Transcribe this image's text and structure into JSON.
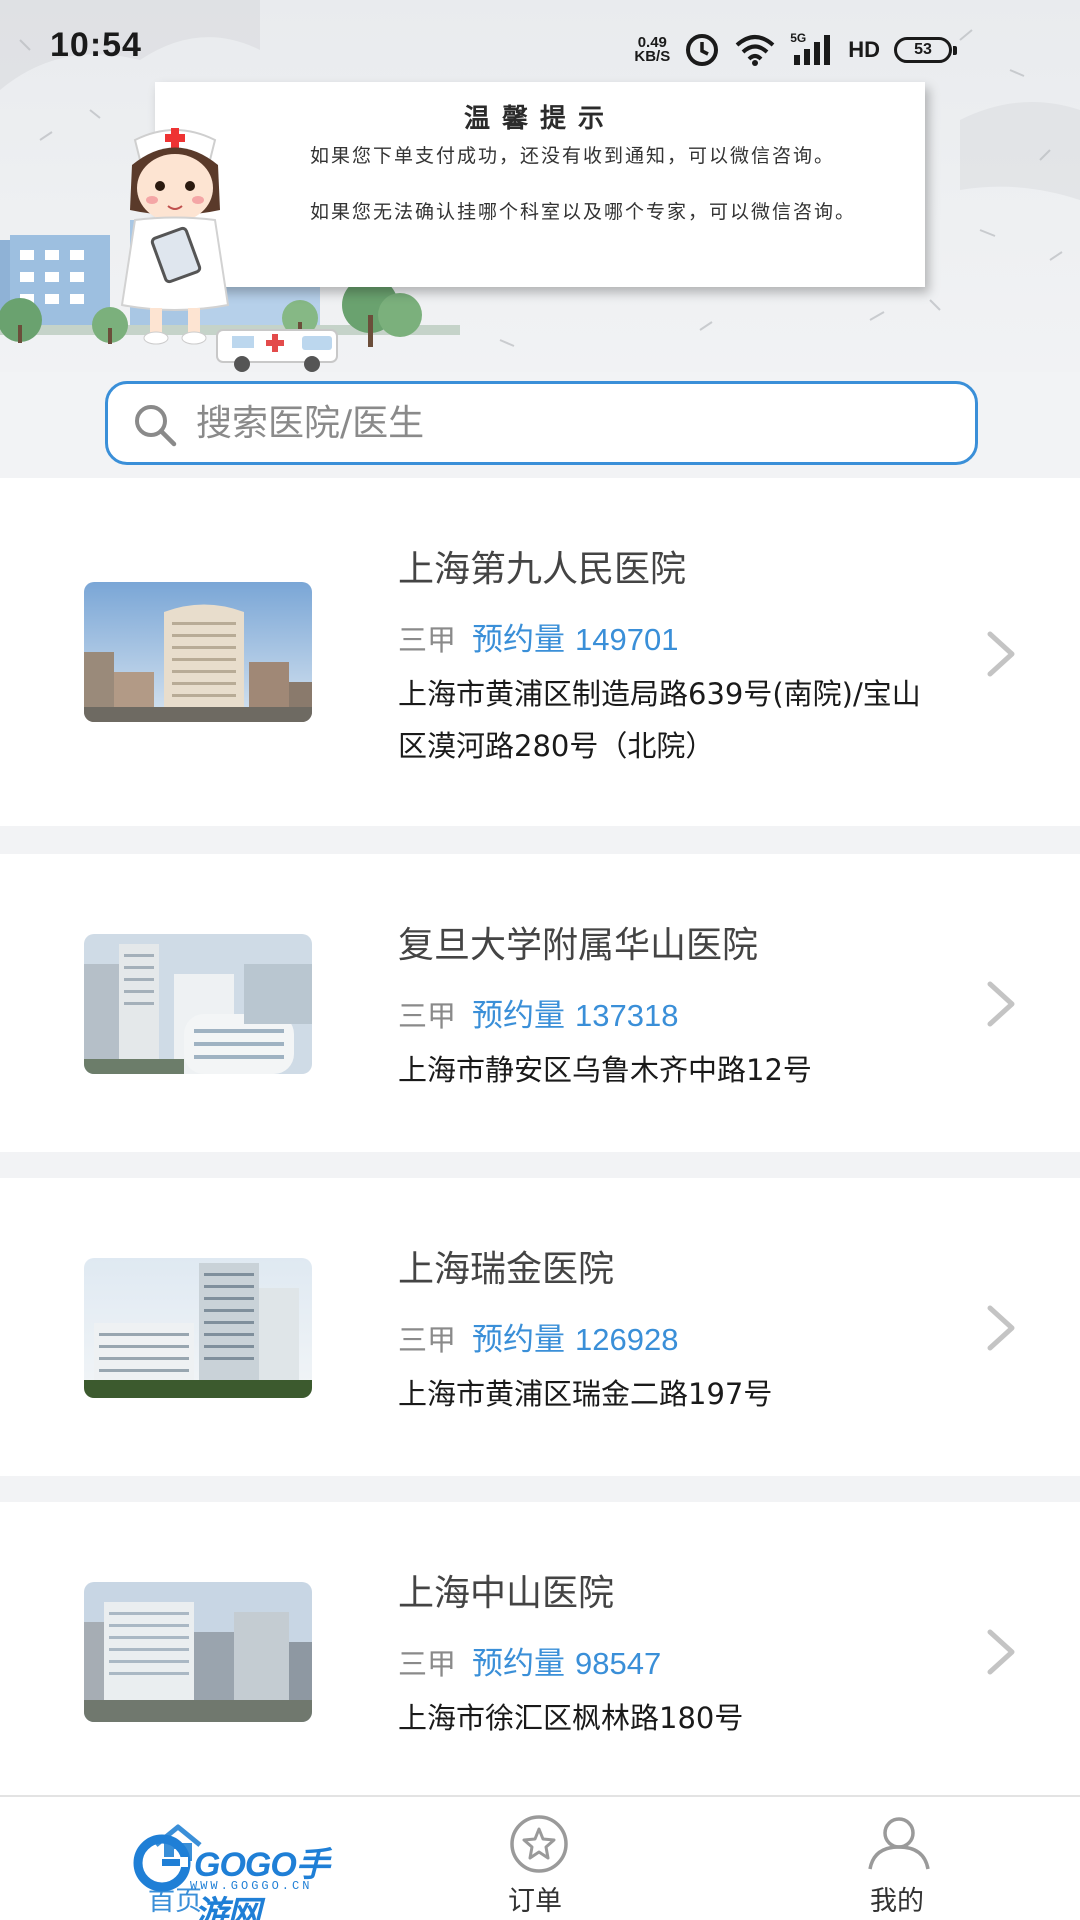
{
  "status_bar": {
    "time": "10:54",
    "net_speed_value": "0.49",
    "net_speed_unit": "KB/S",
    "signal_label": "5G",
    "hd_label": "HD",
    "battery": "53"
  },
  "notice": {
    "title": "温馨提示",
    "line1": "如果您下单支付成功，还没有收到通知，可以微信咨询。",
    "line2": "如果您无法确认挂哪个科室以及哪个专家，可以微信咨询。"
  },
  "search": {
    "placeholder": "搜索医院/医生"
  },
  "hospitals": [
    {
      "name": "上海第九人民医院",
      "level": "三甲",
      "count_label": "预约量",
      "count": "149701",
      "address": "上海市黄浦区制造局路639号(南院)/宝山区漠河路280号（北院）"
    },
    {
      "name": "复旦大学附属华山医院",
      "level": "三甲",
      "count_label": "预约量",
      "count": "137318",
      "address": "上海市静安区乌鲁木齐中路12号"
    },
    {
      "name": "上海瑞金医院",
      "level": "三甲",
      "count_label": "预约量",
      "count": "126928",
      "address": "上海市黄浦区瑞金二路197号"
    },
    {
      "name": "上海中山医院",
      "level": "三甲",
      "count_label": "预约量",
      "count": "98547",
      "address": "上海市徐汇区枫林路180号"
    }
  ],
  "bottom_nav": {
    "home_label": "首页",
    "orders_label": "订单",
    "mine_label": "我的"
  },
  "watermark": {
    "text": "GOGO手游网",
    "url": "WWW.GOGGO.CN"
  },
  "colors": {
    "accent": "#3a8fd8",
    "level_gray": "#8a8a8a",
    "background": "#f2f3f5"
  }
}
